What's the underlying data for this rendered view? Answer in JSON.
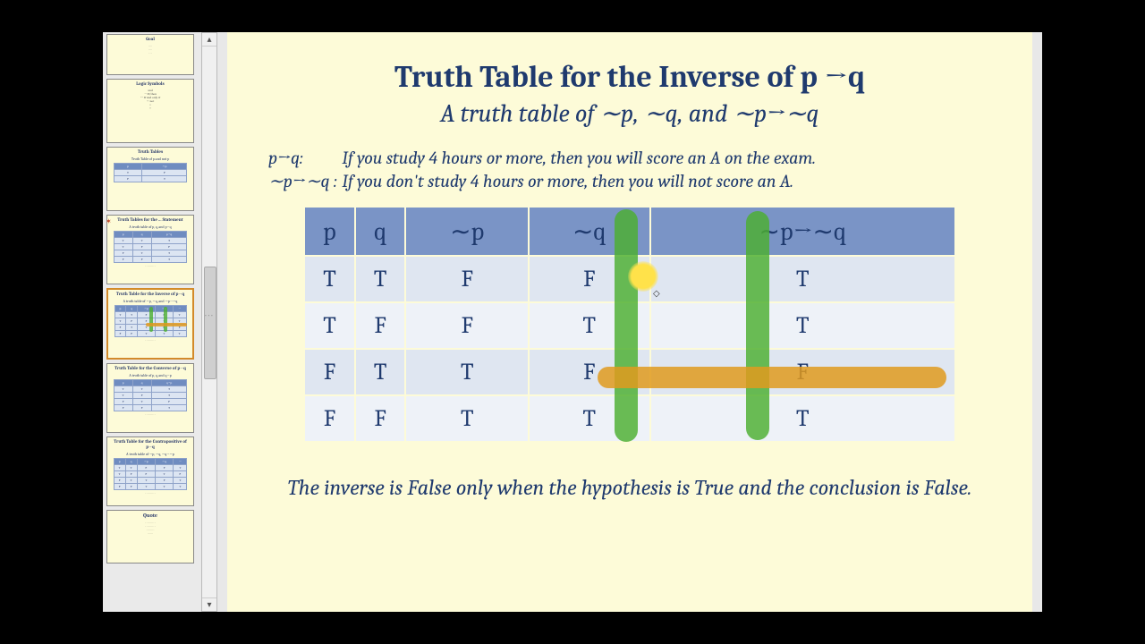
{
  "slide": {
    "title": "Truth Table for the Inverse of p →q",
    "subtitle": "A truth table of ∼p, ∼q, and ∼p→∼q",
    "statement1_label": "p→q:",
    "statement1_text": "If you study 4 hours or more, then you will score an A on the exam.",
    "statement2_label": "∼p→∼q :",
    "statement2_text": "If you don't study 4 hours or more, then you will not score an A.",
    "footer": "The inverse is False only when the hypothesis is True and the conclusion is False."
  },
  "table": {
    "headers": [
      "p",
      "q",
      "∼p",
      "∼q",
      "∼p→∼q"
    ],
    "rows": [
      [
        "T",
        "T",
        "F",
        "F",
        "T"
      ],
      [
        "T",
        "F",
        "F",
        "T",
        "T"
      ],
      [
        "F",
        "T",
        "T",
        "F",
        "F"
      ],
      [
        "F",
        "F",
        "T",
        "T",
        "T"
      ]
    ]
  },
  "thumbs": {
    "t1": {
      "title": "Goal",
      "sub": ""
    },
    "t2": {
      "title": "Logic Symbols",
      "sub": ""
    },
    "t3": {
      "title": "Truth Tables",
      "sub": "Truth Table of p and not p"
    },
    "t4": {
      "title": "Truth Tables for the ... Statement",
      "sub": "A truth table of p, q, and p→q"
    },
    "t5": {
      "title": "Truth Table for the Inverse of p→q",
      "sub": "A truth table of ∼p, ∼q, and ∼p→∼q"
    },
    "t6": {
      "title": "Truth Table for the Converse of p→q",
      "sub": "A truth table of p, q, and q→p"
    },
    "t7": {
      "title": "Truth Table for the Contrapositive of p→q",
      "sub": "A truth table of ∼p, ∼q, ∼q→∼p"
    },
    "t8": {
      "title": "Quote",
      "sub": ""
    }
  }
}
